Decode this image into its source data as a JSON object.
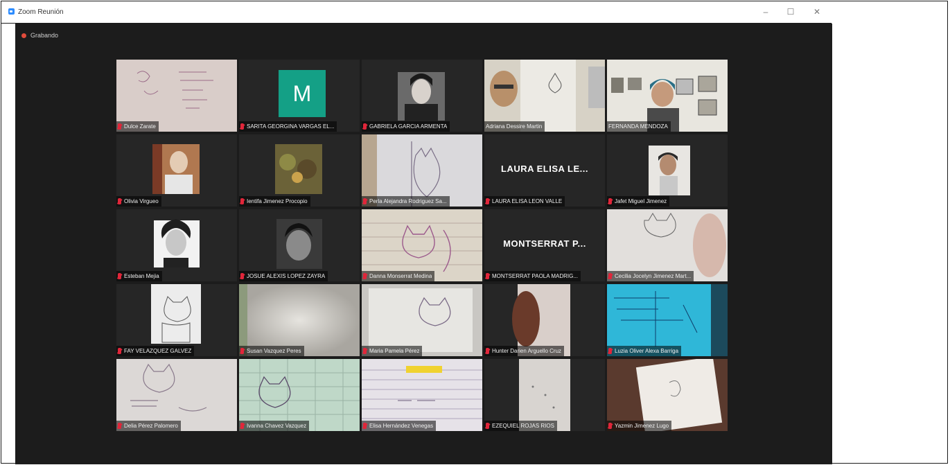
{
  "window": {
    "title": "Zoom Reunión",
    "minimize": "–",
    "maximize": "☐",
    "close": "✕"
  },
  "recording": {
    "label": "Grabando"
  },
  "colors": {
    "client_bg": "#1c1c1c",
    "active_speaker": "#c5d93a",
    "mic_muted": "#e0263a",
    "avatar_teal": "#14a086"
  },
  "participants": [
    {
      "name": "Dulce Zarate",
      "muted": true,
      "kind": "video",
      "scene": "paper-notes"
    },
    {
      "name": "SARITA GEORGINA VARGAS EL...",
      "muted": true,
      "kind": "avatar",
      "avatar_letter": "M"
    },
    {
      "name": "GABRIELA GARCIA ARMENTA",
      "muted": true,
      "kind": "video",
      "scene": "portrait-photo"
    },
    {
      "name": "Adriana Dessire Martin",
      "muted": false,
      "kind": "video",
      "scene": "kid-drawing"
    },
    {
      "name": "FERNANDA MENDOZA",
      "muted": false,
      "kind": "video",
      "scene": "woman-room",
      "active": true
    },
    {
      "name": "Olivia Virgueo",
      "muted": true,
      "kind": "video",
      "scene": "person-photo"
    },
    {
      "name": "Ientifa Jimenez Procopio",
      "muted": true,
      "kind": "video",
      "scene": "nature-photo"
    },
    {
      "name": "Perla Alejandra Rodriguez Sa...",
      "muted": true,
      "kind": "video",
      "scene": "cat-drawing"
    },
    {
      "name": "LAURA ELISA LEON VALLE",
      "muted": true,
      "kind": "name",
      "display": "LAURA ELISA LE..."
    },
    {
      "name": "Jafet Miguel Jimenez",
      "muted": true,
      "kind": "video",
      "scene": "child-photo"
    },
    {
      "name": "Esteban Mejia",
      "muted": true,
      "kind": "video",
      "scene": "bw-portrait"
    },
    {
      "name": "JOSUE ALEXIS LOPEZ ZAYRA",
      "muted": true,
      "kind": "video",
      "scene": "dark-face"
    },
    {
      "name": "Danna Monserrat Medina",
      "muted": true,
      "kind": "video",
      "scene": "cat-drawing-2"
    },
    {
      "name": "MONTSERRAT PAOLA MADRIG...",
      "muted": true,
      "kind": "name",
      "display": "MONTSERRAT P..."
    },
    {
      "name": "Cecilia Jocelyn Jimenez Mart...",
      "muted": true,
      "kind": "video",
      "scene": "hand-drawing"
    },
    {
      "name": "FAY VELAZQUEZ GALVEZ",
      "muted": true,
      "kind": "video",
      "scene": "cat-sketch"
    },
    {
      "name": "Susan Vazquez Peres",
      "muted": true,
      "kind": "video",
      "scene": "blurry-paper"
    },
    {
      "name": "Maria Pamela Pérez",
      "muted": true,
      "kind": "video",
      "scene": "cat-paper"
    },
    {
      "name": "Hunter Darien Arguello Cruz",
      "muted": true,
      "kind": "video",
      "scene": "skin-close"
    },
    {
      "name": "Luzia Oliver Alexa Barriga",
      "muted": true,
      "kind": "video",
      "scene": "blue-screen"
    },
    {
      "name": "Delia Pérez Palomero",
      "muted": true,
      "kind": "video",
      "scene": "cat-whiskers"
    },
    {
      "name": "Ivanna Chavez Vazquez",
      "muted": true,
      "kind": "video",
      "scene": "green-grid"
    },
    {
      "name": "Elisa Hernández Venegas",
      "muted": true,
      "kind": "video",
      "scene": "notebook"
    },
    {
      "name": "EZEQUIEL ROJAS RIOS",
      "muted": true,
      "kind": "video",
      "scene": "paper-close"
    },
    {
      "name": "Yazmin Jimenez Lugo",
      "muted": true,
      "kind": "video",
      "scene": "hand-paper"
    }
  ]
}
